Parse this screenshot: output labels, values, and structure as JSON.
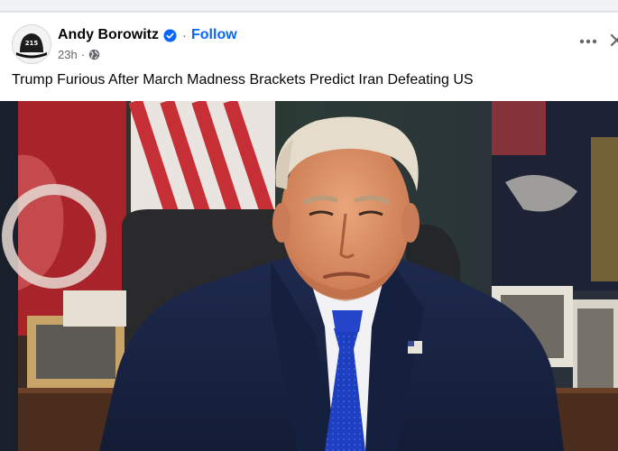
{
  "post": {
    "author_name": "Andy Borowitz",
    "follow_label": "Follow",
    "separator": "·",
    "time_ago": "23h",
    "privacy_icon": "globe-icon",
    "verified_icon": "verified-badge-icon",
    "more_icon": "more-options-icon",
    "text": "Trump Furious After March Madness Brackets Predict Iran Defeating US",
    "avatar_text": "215",
    "image_alt": "Photo of Donald Trump seated at a desk in the Oval Office"
  },
  "colors": {
    "follow": "#0866ff",
    "verified": "#0866ff",
    "meta": "#65676b",
    "text": "#050505"
  }
}
